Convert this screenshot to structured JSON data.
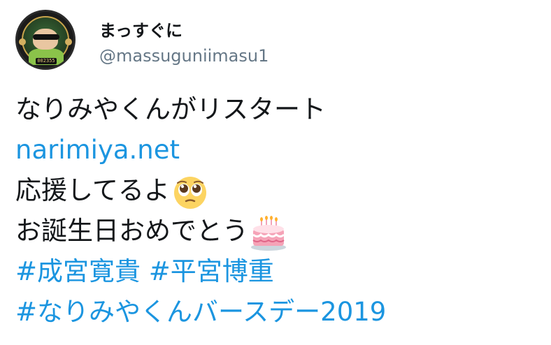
{
  "user": {
    "display_name": "まっすぐに",
    "handle": "@massuguniimasu1",
    "avatar_badge_number": "002355"
  },
  "tweet": {
    "line1": "なりみやくんがリスタート",
    "link": "narimiya.net",
    "line3": "応援してるよ",
    "line4": "お誕生日おめでとう",
    "hashtags_line1": [
      "#成宮寛貴",
      "#平宮博重"
    ],
    "hashtag_line2": "#なりみやくんバースデー2019"
  },
  "colors": {
    "link": "#1b95e0",
    "text": "#14171a",
    "handle": "#657786"
  },
  "icons": {
    "line3_emoji": "pleading-face-icon",
    "line4_emoji": "birthday-cake-icon"
  }
}
